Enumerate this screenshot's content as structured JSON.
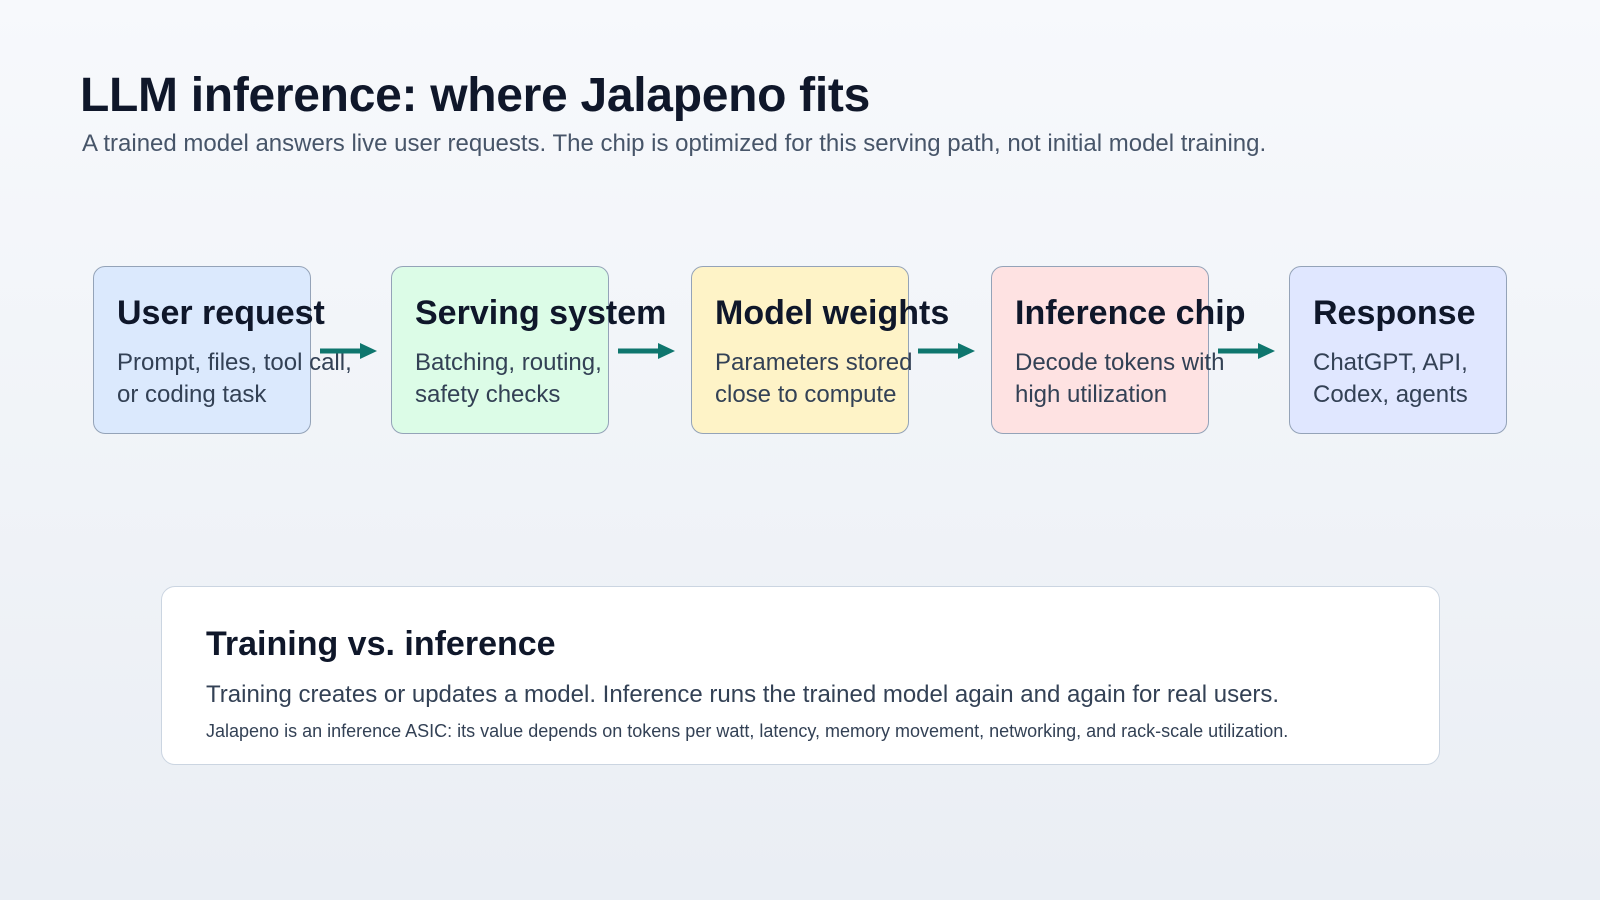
{
  "header": {
    "title": "LLM inference: where Jalapeno fits",
    "subtitle": "A trained model answers live user requests. The chip is optimized for this serving path, not initial model training."
  },
  "colors": {
    "arrow": "#0f766e",
    "step_fills": [
      "#dbe9fd",
      "#dcfce7",
      "#fef3c7",
      "#fee2e2",
      "#e0e7ff"
    ]
  },
  "steps": [
    {
      "title": "User request",
      "line1": "Prompt, files, tool call,",
      "line2": "or coding task"
    },
    {
      "title": "Serving system",
      "line1": "Batching, routing,",
      "line2": "safety checks"
    },
    {
      "title": "Model weights",
      "line1": "Parameters stored",
      "line2": "close to compute"
    },
    {
      "title": "Inference chip",
      "line1": "Decode tokens with",
      "line2": "high utilization"
    },
    {
      "title": "Response",
      "line1": "ChatGPT, API,",
      "line2": "Codex, agents"
    }
  ],
  "callout": {
    "title": "Training vs. inference",
    "body": "Training creates or updates a model. Inference runs the trained model again and again for real users.",
    "note": "Jalapeno is an inference ASIC: its value depends on tokens per watt, latency, memory movement, networking, and rack-scale utilization."
  }
}
